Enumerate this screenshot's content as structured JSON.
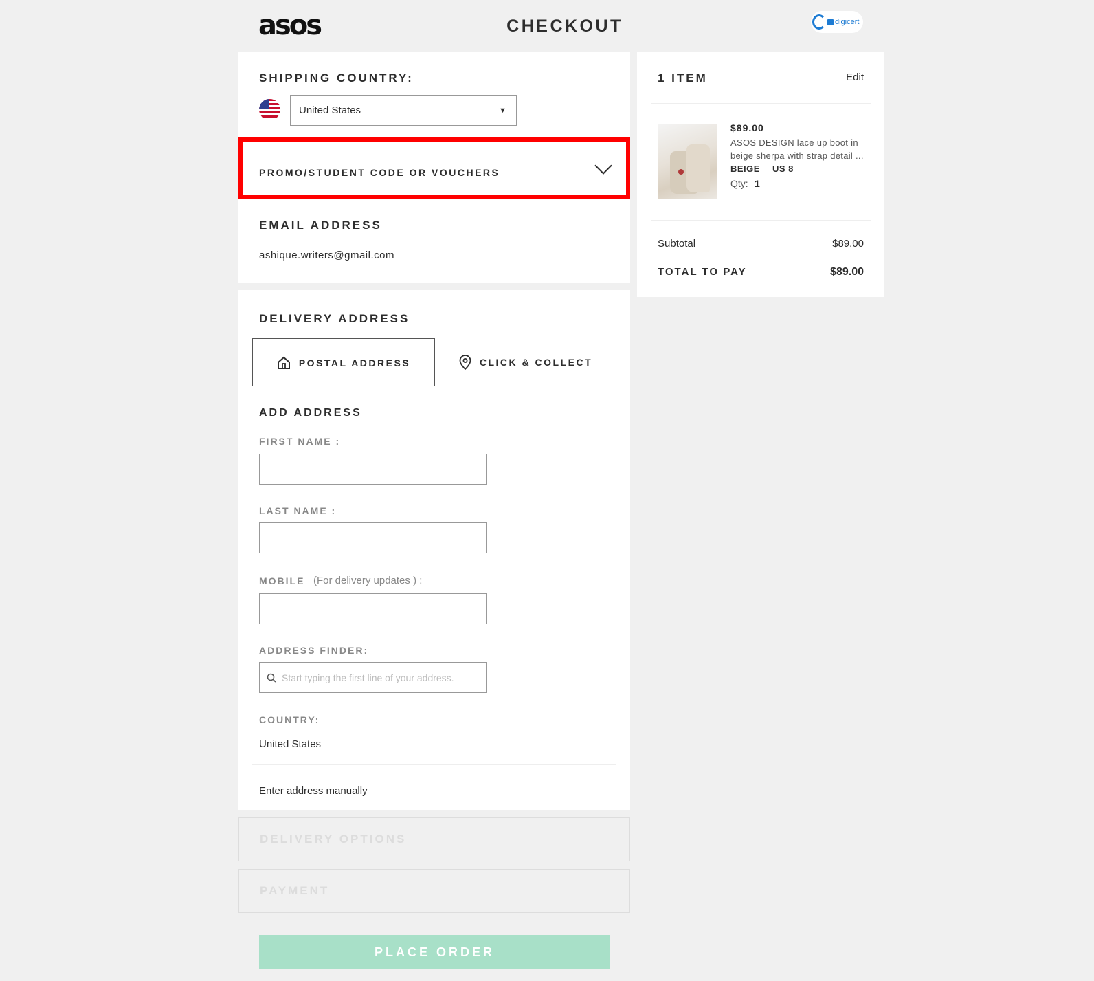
{
  "header": {
    "logo": "asos",
    "title": "CHECKOUT",
    "security_badge": "digicert"
  },
  "shipping": {
    "heading": "SHIPPING COUNTRY:",
    "country_value": "United States",
    "promo_label": "PROMO/STUDENT CODE OR VOUCHERS",
    "email_heading": "EMAIL ADDRESS",
    "email_value": "ashique.writers@gmail.com"
  },
  "delivery": {
    "heading": "DELIVERY ADDRESS",
    "tabs": [
      {
        "label": "POSTAL ADDRESS",
        "icon": "house-icon",
        "active": true
      },
      {
        "label": "CLICK & COLLECT",
        "icon": "location-pin-icon",
        "active": false
      }
    ],
    "add_address_heading": "ADD ADDRESS",
    "first_name_label": "FIRST NAME :",
    "last_name_label": "LAST NAME :",
    "mobile_label": "MOBILE",
    "mobile_hint": "(For delivery updates ) :",
    "finder_label": "ADDRESS FINDER:",
    "finder_placeholder": "Start typing the first line of your address.",
    "country_label": "COUNTRY:",
    "country_value": "United States",
    "manual_link": "Enter address manually"
  },
  "sections": {
    "delivery_options": "DELIVERY OPTIONS",
    "payment": "PAYMENT",
    "place_order": "PLACE ORDER"
  },
  "summary": {
    "heading": "1 ITEM",
    "edit": "Edit",
    "item": {
      "price": "$89.00",
      "name_line1": "ASOS DESIGN lace up boot in",
      "name_line2": "beige sherpa with strap detail ...",
      "color": "BEIGE",
      "size": "US 8",
      "qty_label": "Qty:",
      "qty": "1"
    },
    "subtotal_label": "Subtotal",
    "subtotal_value": "$89.00",
    "total_label": "TOTAL TO PAY",
    "total_value": "$89.00"
  },
  "colors": {
    "highlight": "#ff0000",
    "place_order_bg": "#a8e0c8",
    "accent_blue": "#1d7bd3"
  }
}
